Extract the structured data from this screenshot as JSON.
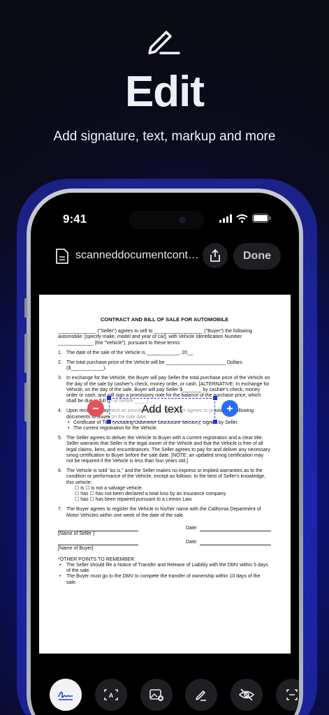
{
  "hero": {
    "icon": "pencil-icon",
    "title": "Edit",
    "subtitle": "Add signature, text, markup and more"
  },
  "status_bar": {
    "time": "9:41",
    "icons": [
      "signal-icon",
      "wifi-icon",
      "battery-icon"
    ]
  },
  "toolbar_top": {
    "doc_icon": "document-icon",
    "filename": "scanneddocumentcontra...",
    "share_icon": "share-icon",
    "done_label": "Done"
  },
  "document": {
    "title": "CONTRACT AND BILL OF SALE FOR AUTOMOBILE",
    "intro": "______________ (\"Seller\") agrees to sell to __________________ (\"Buyer\") the following automobile: [specify make, model and year of car], with Vehicle Identification Number _____________ (the \"Vehicle\"), pursuant to these terms:",
    "items": [
      {
        "num": "1.",
        "text": "The date of the sale of the Vehicle is ____________, 20__."
      },
      {
        "num": "2.",
        "text": "The total purchase price of the Vehicle will be ______________________ Dollars ($____________)."
      },
      {
        "num": "3.",
        "text": "In exchange for the Vehicle, the Buyer will pay Seller the total purchase price of the Vehicle on the day of the sale by cashier's check, money order, or cash. [ALTERNATIVE: In exchange for Vehicle, on the day of the sale, Buyer will pay Seller $_______ by cashier's check, money order or cash, and will sign a promissory note for the balance of the purchase price, which shall be due in full on or before ____.]"
      },
      {
        "num": "4.",
        "text": "Upon receipt of payment as provided above, The Seller agrees to provide the following documents to Buyer on the sale date:",
        "subs": [
          "Certificate of Title (including Odometer Disclosure Section), signed by Seller.",
          "The current registration for the Vehicle."
        ]
      },
      {
        "num": "5.",
        "text": "The Seller agrees to deliver the Vehicle to Buyer with a current registration and a clear title.  Seller warrants that Seller is the legal owner of the Vehicle and that the Vehicle is free of all legal claims, liens, and encumbrances. The Seller agrees to pay for and deliver any necessary smog certification to Buyer before the sale date.  [NOTE: an updated smog certification may not be required if the Vehicle is less than four years old.]"
      },
      {
        "num": "6.",
        "text": "The Vehicle is sold \"as is,\" and the Seller makes no express or implied warranties as to the condition or performance of the Vehicle, except as follows: to the best of Seller's knowledge, this vehicle:",
        "checks": [
          "☐ is  ☐ is not a salvage vehicle.",
          "☐ has  ☐ has not been declared a total loss by an insurance company.",
          "☐ has  ☐ has been repaired pursuant to a Lemon Law."
        ]
      },
      {
        "num": "7.",
        "text": "The Buyer agrees to register the Vehicle in his/her name with the California Department of Motor Vehicles within one week of the date of the sale."
      }
    ],
    "seller_label": "[Name of Seller ]",
    "buyer_label": "[Name of Buyer]",
    "date_label": "Date:",
    "remember_title": "*OTHER POINTS TO REMEMBER:",
    "remember": [
      "The Seller should file a Notice of Transfer and Release of Liability with the DMV within 5 days of the sale.",
      "The Buyer must go to the DMV to compete the transfer of ownership within 10 days of the sale."
    ]
  },
  "text_annotation": {
    "label": "Add text",
    "remove_icon": "minus-icon",
    "add_icon": "plus-icon"
  },
  "tools": [
    {
      "icon": "signature-icon",
      "active": true
    },
    {
      "icon": "text-box-icon",
      "active": false
    },
    {
      "icon": "add-image-icon",
      "active": false
    },
    {
      "icon": "pen-icon",
      "active": false
    },
    {
      "icon": "eye-off-icon",
      "active": false
    },
    {
      "icon": "scan-icon",
      "active": false
    }
  ],
  "colors": {
    "accent_blue": "#2233e0",
    "remove_red": "#e5505c",
    "add_blue": "#2a6cf5"
  }
}
